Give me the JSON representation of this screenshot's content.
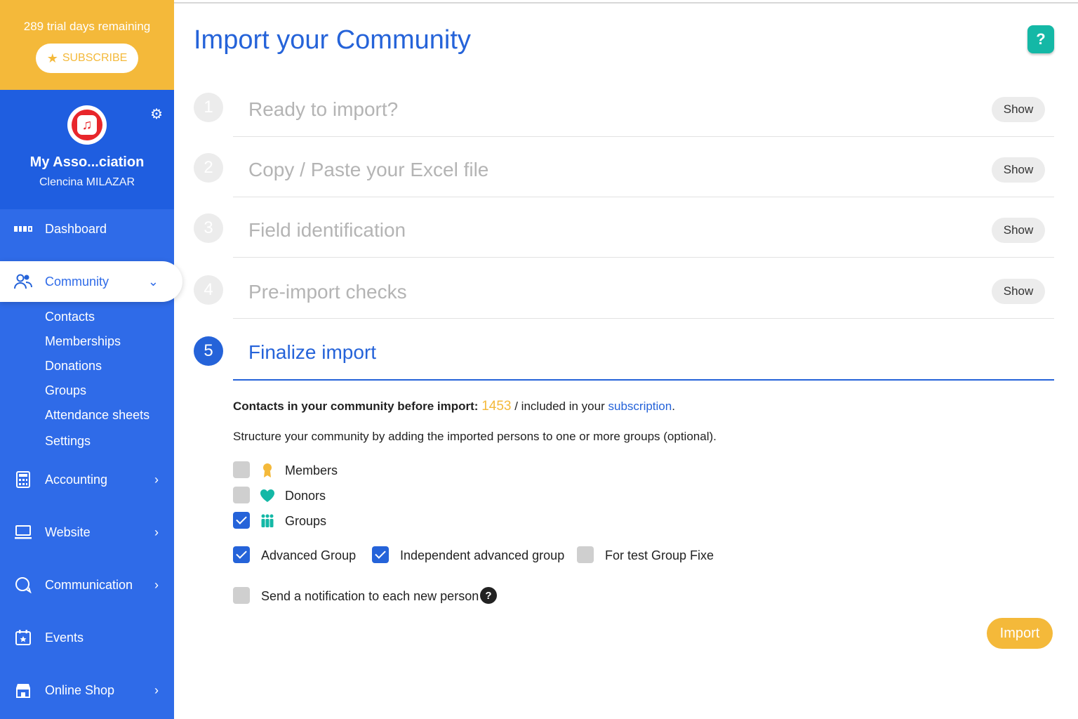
{
  "trial": {
    "text": "289 trial days remaining",
    "subscribe_label": "SUBSCRIBE"
  },
  "association": {
    "name": "My Asso...ciation",
    "user": "Clencina MILAZAR"
  },
  "nav": {
    "dashboard": "Dashboard",
    "community": "Community",
    "community_sub": [
      "Contacts",
      "Memberships",
      "Donations",
      "Groups",
      "Attendance sheets",
      "Settings"
    ],
    "accounting": "Accounting",
    "website": "Website",
    "communication": "Communication",
    "events": "Events",
    "online_shop": "Online Shop"
  },
  "page": {
    "title": "Import your Community",
    "help_label": "?"
  },
  "steps": [
    {
      "num": "1",
      "title": "Ready to import?",
      "action": "Show"
    },
    {
      "num": "2",
      "title": "Copy / Paste your Excel file",
      "action": "Show"
    },
    {
      "num": "3",
      "title": "Field identification",
      "action": "Show"
    },
    {
      "num": "4",
      "title": "Pre-import checks",
      "action": "Show"
    },
    {
      "num": "5",
      "title": "Finalize import"
    }
  ],
  "finalize": {
    "contacts_label": "Contacts in your community before import:",
    "contacts_count": "1453",
    "included_text": "/ included in your",
    "subscription_link": "subscription",
    "period": ".",
    "structure_text": "Structure your community by adding the imported persons to one or more groups (optional).",
    "group_types": [
      {
        "label": "Members",
        "checked": false,
        "icon": "award-icon",
        "color": "#f4b93a"
      },
      {
        "label": "Donors",
        "checked": false,
        "icon": "heart-icon",
        "color": "#14b8a6"
      },
      {
        "label": "Groups",
        "checked": true,
        "icon": "people-icon",
        "color": "#14b8a6"
      }
    ],
    "groups": [
      {
        "label": "Advanced Group",
        "checked": true
      },
      {
        "label": "Independent advanced group",
        "checked": true
      },
      {
        "label": "For test Group Fixe",
        "checked": false
      }
    ],
    "notification": {
      "label": "Send a notification to each new person",
      "checked": false,
      "help": "?"
    },
    "import_label": "Import"
  },
  "colors": {
    "primary": "#2563d9",
    "sidebar": "#2f6be8",
    "accent": "#f4b93a",
    "teal": "#14b8a6"
  }
}
